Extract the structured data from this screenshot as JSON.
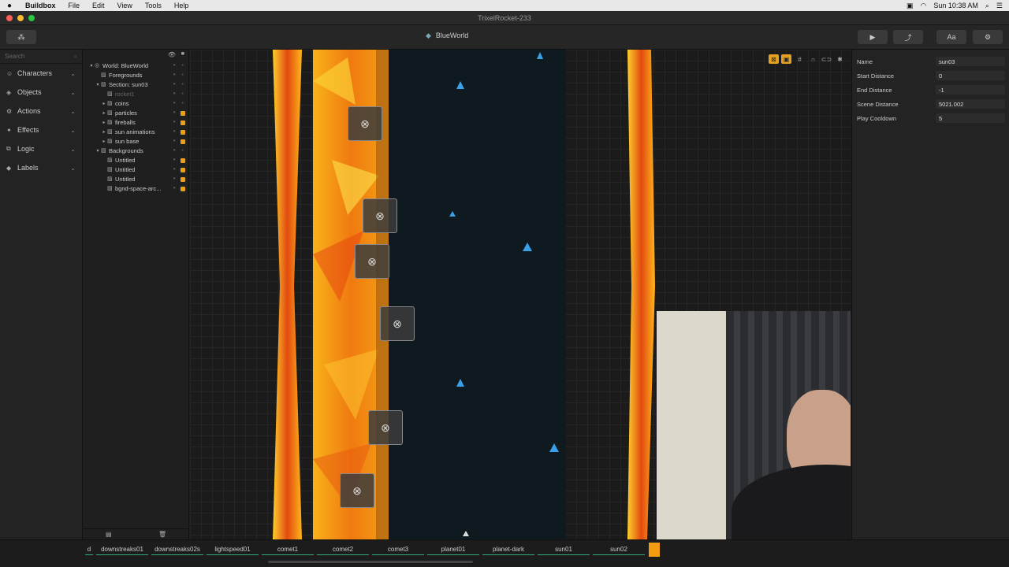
{
  "menubar": {
    "apple": "",
    "app": "Buildbox",
    "items": [
      "File",
      "Edit",
      "View",
      "Tools",
      "Help"
    ],
    "clock": "Sun 10:38 AM"
  },
  "window": {
    "title": "TrixelRocket-233"
  },
  "toolbar": {
    "world": "BlueWorld",
    "font_btn": "Aa"
  },
  "sidebar": {
    "search_placeholder": "Search",
    "categories": [
      {
        "label": "Characters",
        "icon": "person-icon"
      },
      {
        "label": "Objects",
        "icon": "cube-icon"
      },
      {
        "label": "Actions",
        "icon": "gear-icon"
      },
      {
        "label": "Effects",
        "icon": "sparkle-icon"
      },
      {
        "label": "Logic",
        "icon": "logic-icon"
      },
      {
        "label": "Labels",
        "icon": "tag-icon"
      }
    ]
  },
  "tree": [
    {
      "label": "World: BlueWorld",
      "depth": 0,
      "arrow": "▾",
      "locked": false,
      "dim": false
    },
    {
      "label": "Foregrounds",
      "depth": 1,
      "arrow": "",
      "locked": false,
      "dim": false
    },
    {
      "label": "Section: sun03",
      "depth": 1,
      "arrow": "▾",
      "locked": false,
      "dim": false
    },
    {
      "label": "rocket1",
      "depth": 2,
      "arrow": "",
      "locked": false,
      "dim": true
    },
    {
      "label": "coins",
      "depth": 2,
      "arrow": "▸",
      "locked": false,
      "dim": false
    },
    {
      "label": "particles",
      "depth": 2,
      "arrow": "▸",
      "locked": true,
      "dim": false
    },
    {
      "label": "fireballs",
      "depth": 2,
      "arrow": "▸",
      "locked": true,
      "dim": false
    },
    {
      "label": "sun animations",
      "depth": 2,
      "arrow": "▸",
      "locked": true,
      "dim": false
    },
    {
      "label": "sun base",
      "depth": 2,
      "arrow": "▸",
      "locked": true,
      "dim": false
    },
    {
      "label": "Backgrounds",
      "depth": 1,
      "arrow": "▾",
      "locked": false,
      "dim": false
    },
    {
      "label": "Untitled",
      "depth": 2,
      "arrow": "",
      "locked": true,
      "dim": false
    },
    {
      "label": "Untitled",
      "depth": 2,
      "arrow": "",
      "locked": true,
      "dim": false
    },
    {
      "label": "Untitled",
      "depth": 2,
      "arrow": "",
      "locked": true,
      "dim": false
    },
    {
      "label": "bgnd-space-arc...",
      "depth": 2,
      "arrow": "",
      "locked": true,
      "dim": false
    }
  ],
  "properties": [
    {
      "label": "Name",
      "value": "sun03"
    },
    {
      "label": "Start Distance",
      "value": "0"
    },
    {
      "label": "End Distance",
      "value": "-1"
    },
    {
      "label": "Scene Distance",
      "value": "5021.002"
    },
    {
      "label": "Play Cooldown",
      "value": "5"
    }
  ],
  "bottombar": {
    "items": [
      "d",
      "downstreaks01",
      "downstreaks02s",
      "lightspeed01",
      "comet1",
      "comet2",
      "comet3",
      "planet01",
      "planet-dark",
      "sun01",
      "sun02"
    ]
  },
  "colors": {
    "accent": "#e6a020",
    "fire": "#f28a12",
    "space": "#0f1a20"
  }
}
